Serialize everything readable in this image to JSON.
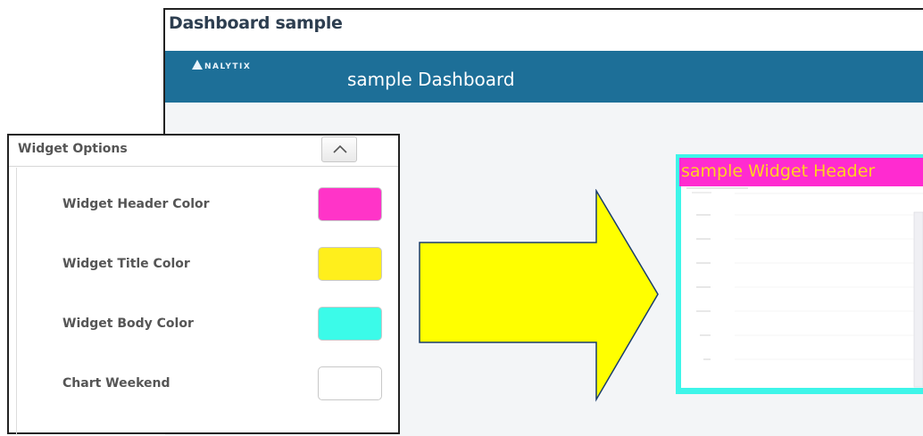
{
  "dashboard": {
    "window_title": "Dashboard sample",
    "logo_text": "NALYTIX",
    "app_title": "sample Dashboard"
  },
  "widget_options": {
    "title": "Widget Options",
    "collapse_icon": "chevron-up-icon",
    "options": [
      {
        "label": "Widget Header Color",
        "color": "#ff34c8"
      },
      {
        "label": "Widget Title Color",
        "color": "#ffef1c"
      },
      {
        "label": "Widget Body Color",
        "color": "#3bfbe9"
      },
      {
        "label": "Chart Weekend",
        "color": "#ffffff"
      }
    ]
  },
  "arrow": {
    "icon": "right-arrow-icon",
    "fill": "#ffff00"
  },
  "preview": {
    "header_text": "sample Widget Header",
    "header_color": "#ff2bd0",
    "title_color": "#ffd21f",
    "body_color": "#3ef5e9"
  }
}
